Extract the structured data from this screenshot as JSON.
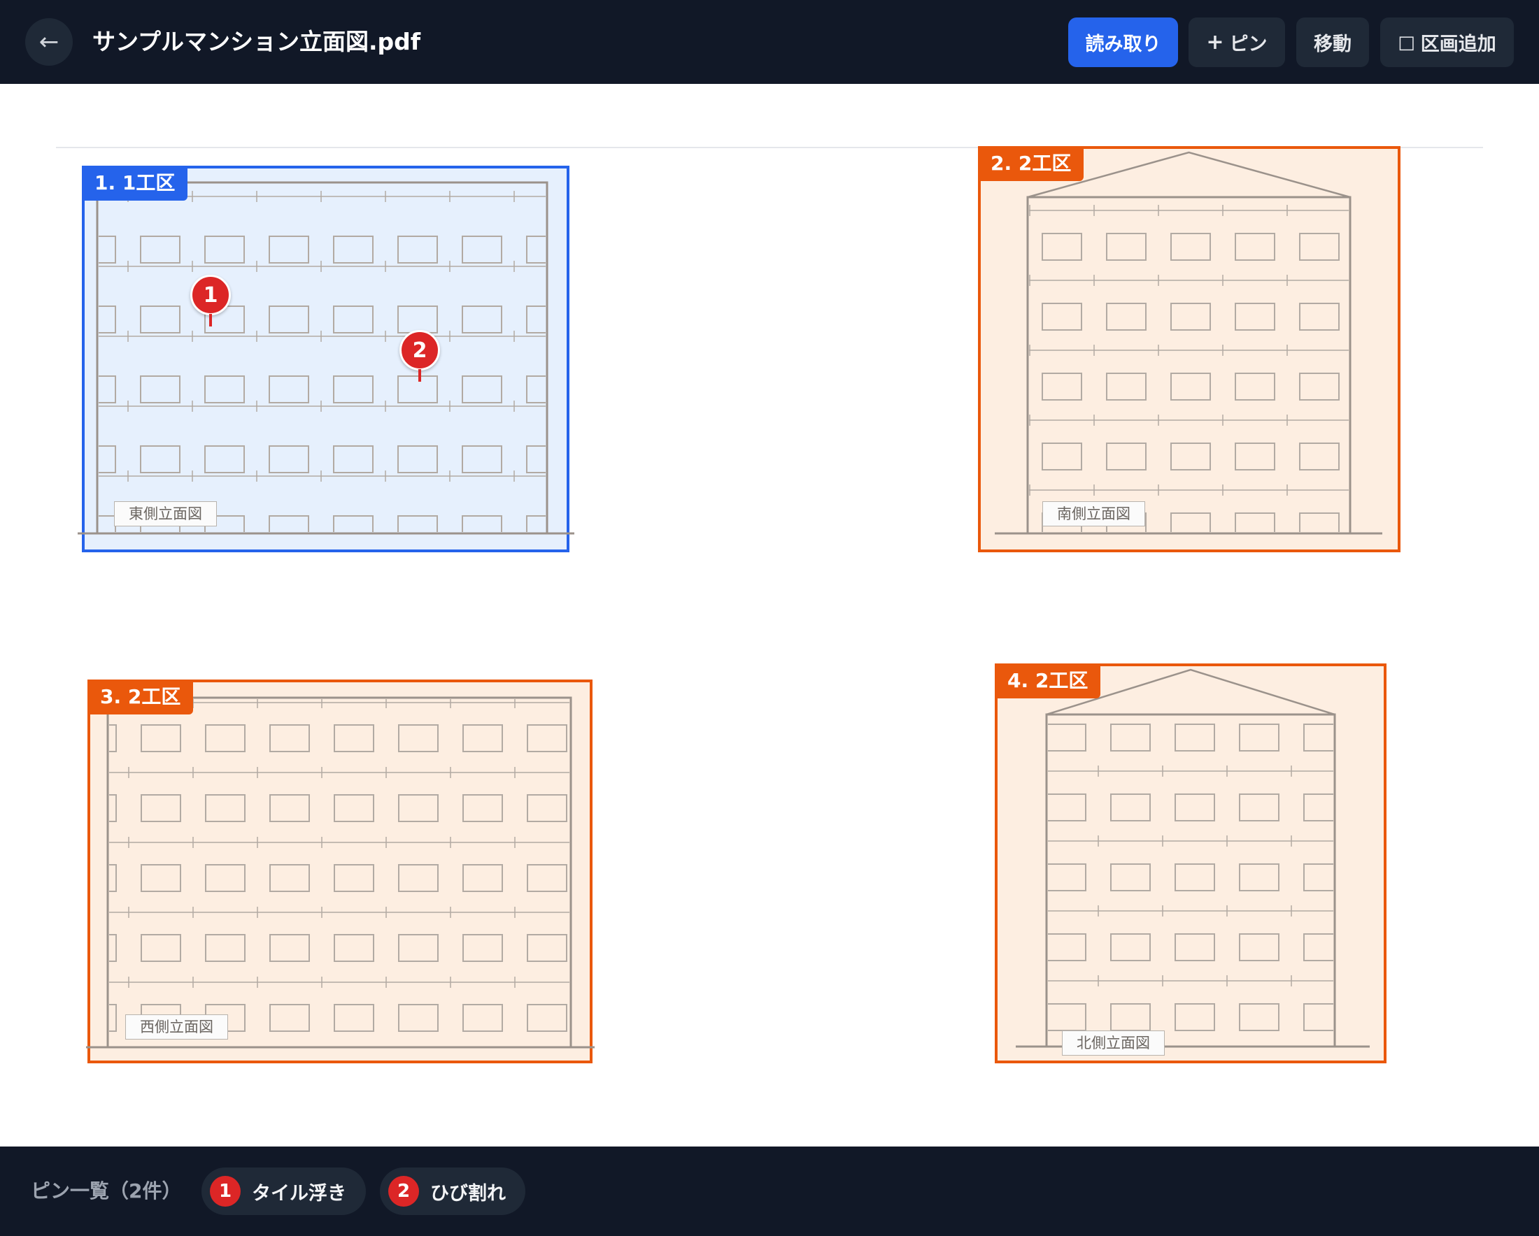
{
  "header": {
    "back_label": "←",
    "title": "サンプルマンション立面図.pdf",
    "buttons": {
      "read": "読み取り",
      "add_pin_glyph": "+",
      "add_pin": "ピン",
      "move": "移動",
      "add_section_glyph": "□",
      "add_section": "区画追加"
    }
  },
  "regions": [
    {
      "badge": "1. 1工区",
      "elevation": "東側立面図",
      "color": "#2563eb",
      "active": true
    },
    {
      "badge": "2. 2工区",
      "elevation": "南側立面図",
      "color": "#ea580c",
      "active": false
    },
    {
      "badge": "3. 2工区",
      "elevation": "西側立面図",
      "color": "#ea580c",
      "active": false
    },
    {
      "badge": "4. 2工区",
      "elevation": "北側立面図",
      "color": "#ea580c",
      "active": false
    }
  ],
  "pins": [
    {
      "number": "1",
      "label": "タイル浮き"
    },
    {
      "number": "2",
      "label": "ひび割れ"
    }
  ],
  "pin_list": {
    "title": "ピン一覧（2件）"
  },
  "colors": {
    "topbar": "#111827",
    "primary": "#2563eb",
    "section_orange": "#ea580c",
    "pin_red": "#dc2626"
  }
}
